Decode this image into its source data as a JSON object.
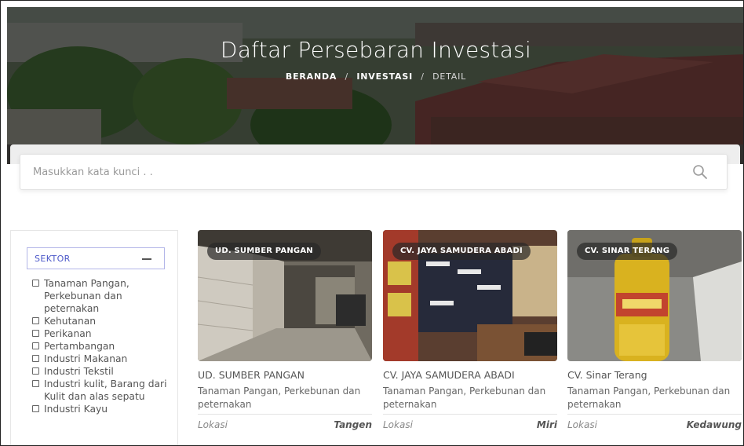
{
  "hero": {
    "title": "Daftar Persebaran Investasi",
    "breadcrumb": [
      "BERANDA",
      "INVESTASI",
      "DETAIL"
    ]
  },
  "search": {
    "placeholder": "Masukkan kata kunci . .",
    "icon": "search-icon"
  },
  "sidebar": {
    "filter_title": "SEKTOR",
    "toggle_icon": "minus-icon",
    "sectors": [
      "Tanaman Pangan, Perkebunan dan peternakan",
      "Kehutanan",
      "Perikanan",
      "Pertambangan",
      "Industri Makanan",
      "Industri Tekstil",
      "Industri kulit, Barang dari Kulit dan alas sepatu",
      "Industri Kayu"
    ]
  },
  "cards": [
    {
      "tag": "UD. SUMBER PANGAN",
      "name": "UD. SUMBER PANGAN",
      "sector": "Tanaman Pangan, Perkebunan dan peternakan",
      "location_label": "Lokasi",
      "location": "Tangen"
    },
    {
      "tag": "CV. JAYA SAMUDERA ABADI",
      "name": "CV. JAYA SAMUDERA ABADI",
      "sector": "Tanaman Pangan, Perkebunan dan peternakan",
      "location_label": "Lokasi",
      "location": "Miri"
    },
    {
      "tag": "CV. SINAR TERANG",
      "name": "CV. Sinar Terang",
      "sector": "Tanaman Pangan, Perkebunan dan peternakan",
      "location_label": "Lokasi",
      "location": "Kedawung"
    }
  ],
  "colors": {
    "accent": "#4c58c9",
    "filter_border": "#b3b6e8"
  }
}
